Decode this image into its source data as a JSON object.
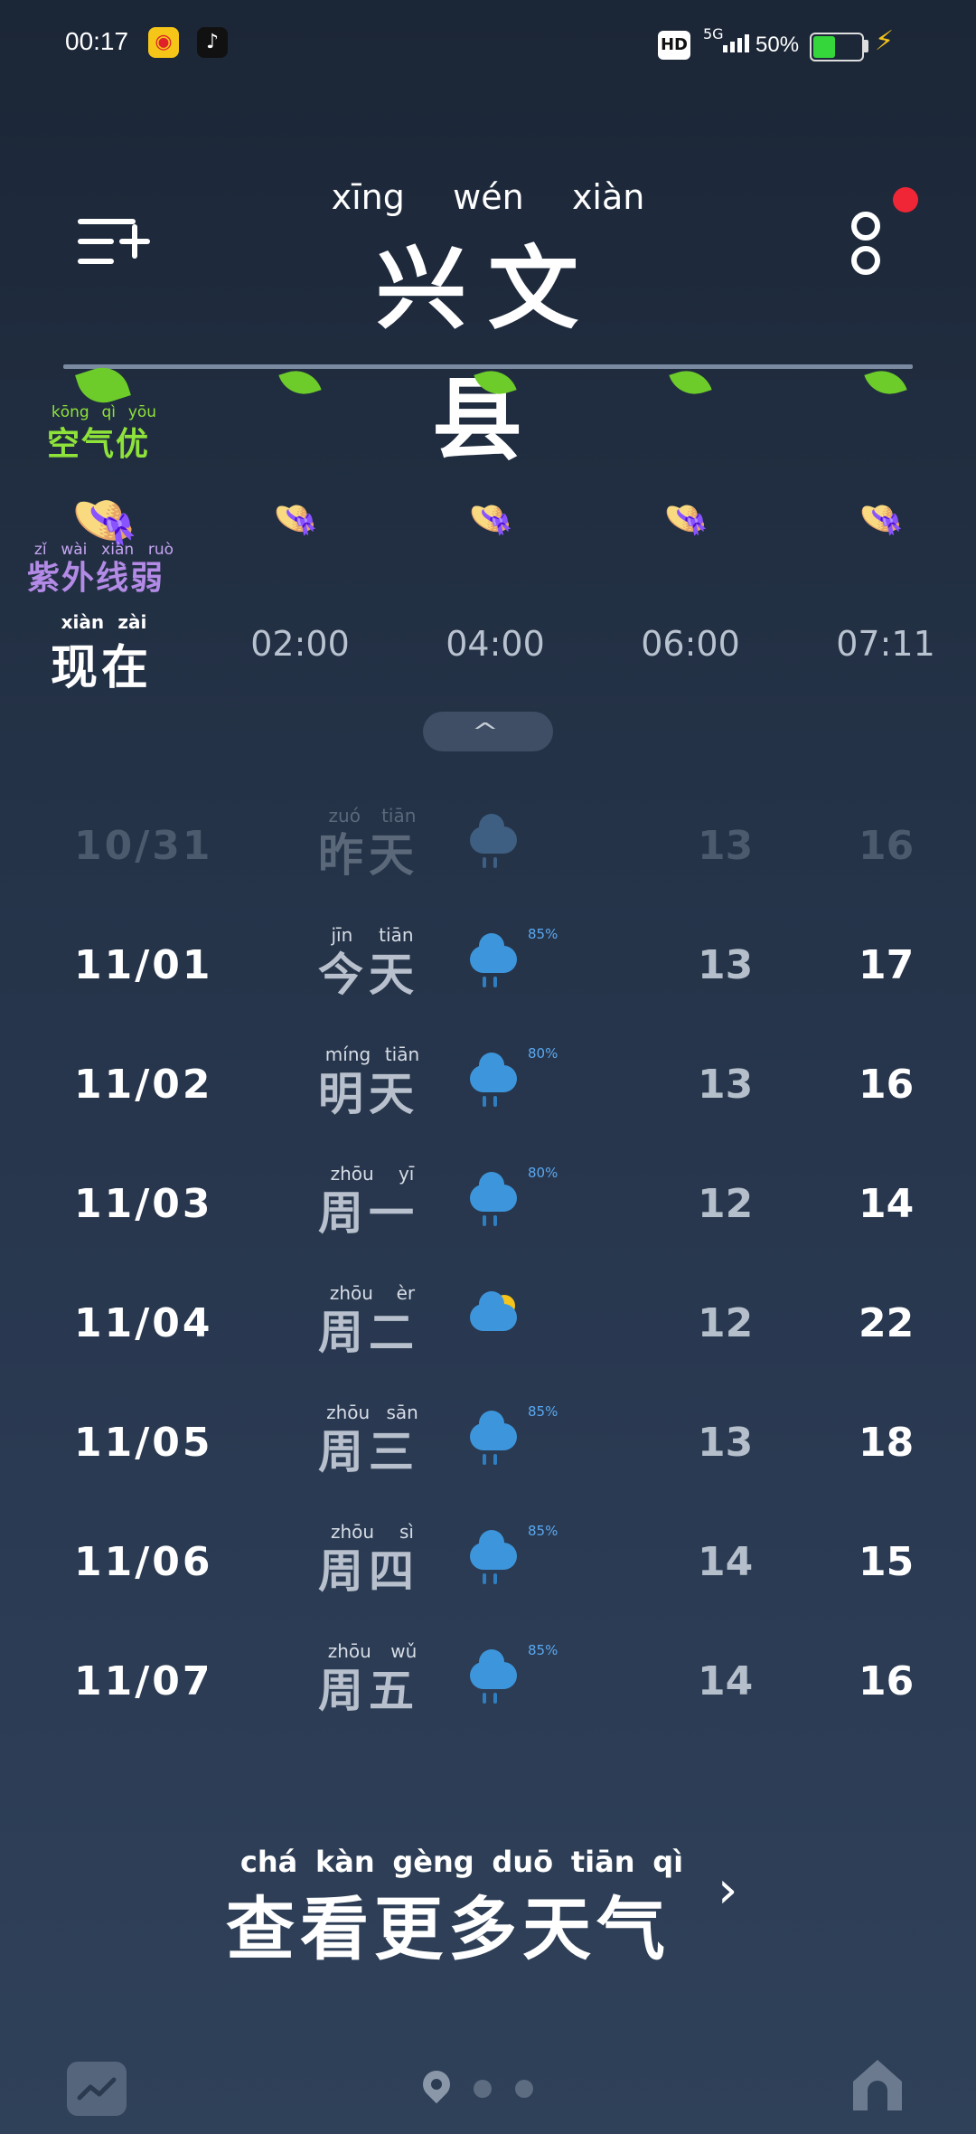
{
  "status_bar": {
    "time": "00:17",
    "weibo_icon": "weibo-icon",
    "tiktok_icon": "tiktok-icon",
    "hd": "HD",
    "network": "5G",
    "battery_percent": "50%",
    "battery_level": 0.5,
    "charging_icon": "lightning-icon"
  },
  "header": {
    "city_pinyin": [
      "xīng",
      "wén",
      "xiàn"
    ],
    "city": "兴文县"
  },
  "hourly": {
    "air_quality_pinyin": [
      "kōng",
      "qì",
      "yōu"
    ],
    "air_quality": "空气优",
    "uv_pinyin": [
      "zǐ",
      "wài",
      "xiàn",
      "ruò"
    ],
    "uv": "紫外线弱",
    "now_pinyin": [
      "xiàn",
      "zài"
    ],
    "now": "现在",
    "times": [
      "02:00",
      "04:00",
      "06:00",
      "07:11"
    ]
  },
  "daily": [
    {
      "date": "10/31",
      "day_pinyin": [
        "zuó",
        "tiān"
      ],
      "day": "昨天",
      "icon": "rain",
      "prob": "",
      "low": "13",
      "high": "16",
      "past": true
    },
    {
      "date": "11/01",
      "day_pinyin": [
        "jīn",
        "tiān"
      ],
      "day": "今天",
      "icon": "rain",
      "prob": "85%",
      "low": "13",
      "high": "17"
    },
    {
      "date": "11/02",
      "day_pinyin": [
        "míng",
        "tiān"
      ],
      "day": "明天",
      "icon": "rain",
      "prob": "80%",
      "low": "13",
      "high": "16"
    },
    {
      "date": "11/03",
      "day_pinyin": [
        "zhōu",
        "yī"
      ],
      "day": "周一",
      "icon": "rain",
      "prob": "80%",
      "low": "12",
      "high": "14"
    },
    {
      "date": "11/04",
      "day_pinyin": [
        "zhōu",
        "èr"
      ],
      "day": "周二",
      "icon": "partly-cloudy",
      "prob": "",
      "low": "12",
      "high": "22"
    },
    {
      "date": "11/05",
      "day_pinyin": [
        "zhōu",
        "sān"
      ],
      "day": "周三",
      "icon": "rain",
      "prob": "85%",
      "low": "13",
      "high": "18"
    },
    {
      "date": "11/06",
      "day_pinyin": [
        "zhōu",
        "sì"
      ],
      "day": "周四",
      "icon": "rain",
      "prob": "85%",
      "low": "14",
      "high": "15"
    },
    {
      "date": "11/07",
      "day_pinyin": [
        "zhōu",
        "wǔ"
      ],
      "day": "周五",
      "icon": "rain",
      "prob": "85%",
      "low": "14",
      "high": "16"
    }
  ],
  "more_weather": {
    "pinyin": [
      "chá",
      "kàn",
      "gèng",
      "duō",
      "tiān",
      "qì"
    ],
    "label": "查看更多天气"
  },
  "colors": {
    "air": "#8ee23a",
    "uv": "#b38ae6",
    "rain": "#3d96dc",
    "badge": "#f02636"
  }
}
